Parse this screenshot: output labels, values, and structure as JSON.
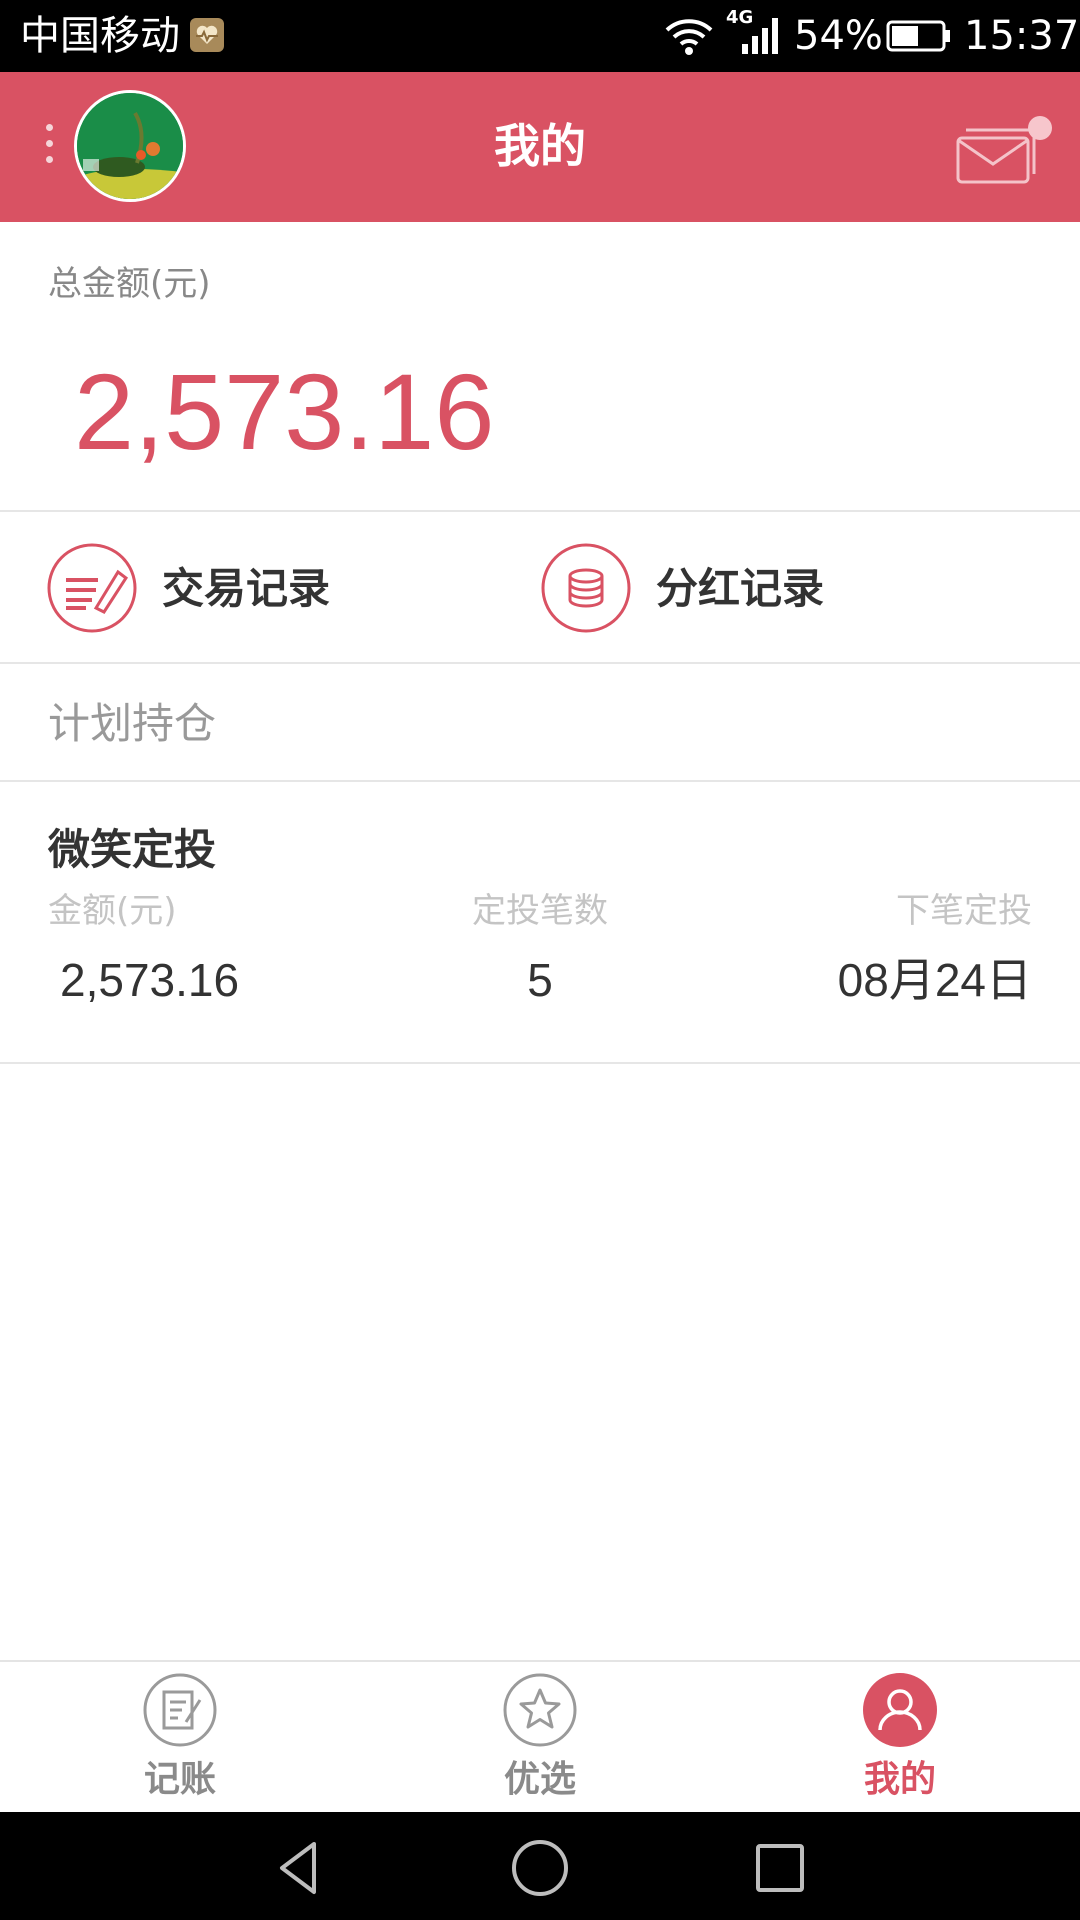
{
  "status_bar": {
    "carrier": "中国移动",
    "network_type": "4G",
    "battery_percent": "54%",
    "time": "15:37",
    "battery_level": 0.54
  },
  "header": {
    "title": "我的"
  },
  "total": {
    "label": "总金额(元)",
    "value": "2,573.16"
  },
  "records": [
    {
      "label": "交易记录",
      "icon": "trade-record-icon"
    },
    {
      "label": "分红记录",
      "icon": "dividend-record-icon"
    }
  ],
  "holdings": {
    "title": "计划持仓",
    "plan": {
      "name": "微笑定投",
      "columns": [
        {
          "label": "金额(元)",
          "value": "2,573.16"
        },
        {
          "label": "定投笔数",
          "value": "5"
        },
        {
          "label": "下笔定投",
          "value": "08月24日"
        }
      ]
    }
  },
  "tabs": [
    {
      "label": "记账",
      "icon": "bookkeeping-icon",
      "active": false
    },
    {
      "label": "优选",
      "icon": "star-icon",
      "active": false
    },
    {
      "label": "我的",
      "icon": "person-icon",
      "active": true
    }
  ],
  "colors": {
    "brand": "#d95263",
    "status_bar": "#000000",
    "nav_bar": "#000000"
  }
}
